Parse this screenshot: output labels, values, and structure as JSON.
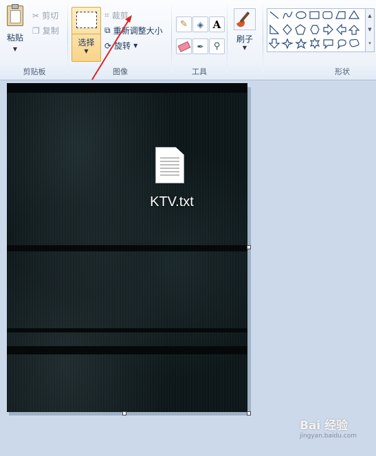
{
  "clipboard": {
    "paste": "粘贴",
    "cut": "剪切",
    "copy": "复制",
    "group": "剪贴板"
  },
  "image_group": {
    "select": "选择",
    "crop": "裁剪",
    "resize": "重新调整大小",
    "rotate": "旋转",
    "group": "图像"
  },
  "tools": {
    "group": "工具"
  },
  "brushes": {
    "label": "刷子"
  },
  "shapes": {
    "group": "形状"
  },
  "canvas": {
    "file_label": "KTV.txt"
  },
  "watermark": {
    "brand": "Bai 经验",
    "url": "jingyan.baidu.com"
  },
  "colors": {
    "accent": "#e02020",
    "selected": "#f8d48a"
  }
}
